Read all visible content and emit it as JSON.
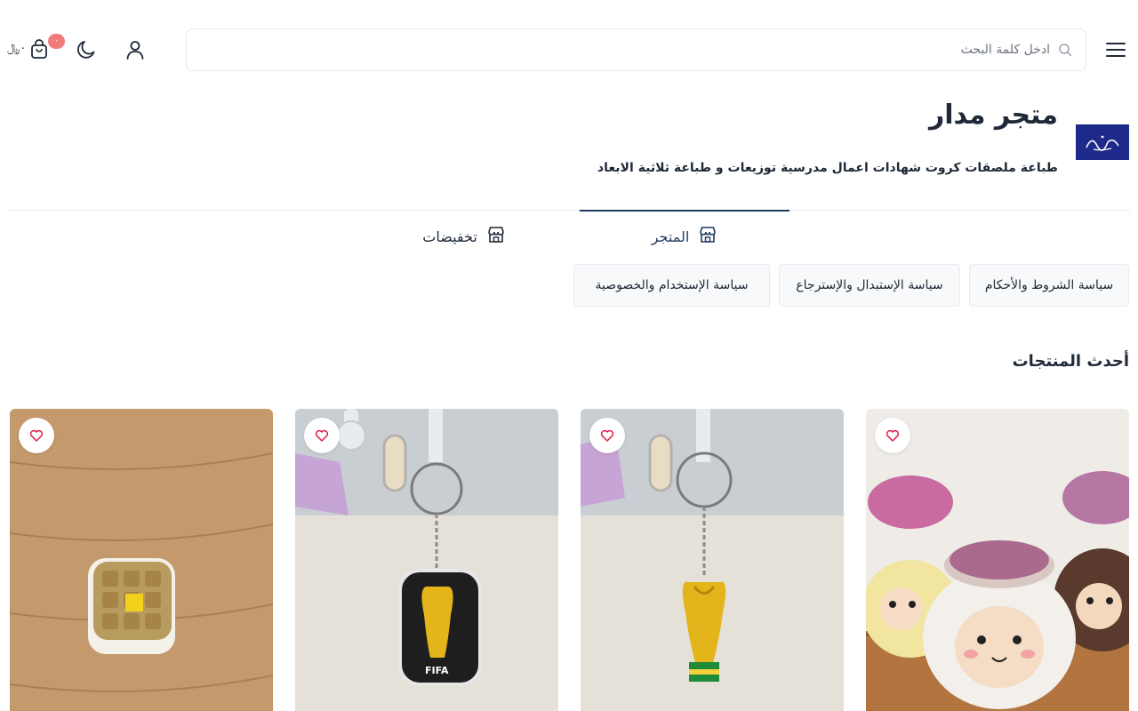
{
  "header": {
    "search_placeholder": "ادخل كلمة البحث",
    "cart_total": "٠﷼",
    "cart_count": "٠"
  },
  "store": {
    "name": "متجر مدار",
    "description": "طباعة ملصقات كروت شهادات اعمال مدرسية توزيعات و طباعة ثلاثية الابعاد",
    "logo_color": "#1e2a8a"
  },
  "tabs": [
    {
      "label": "المتجر",
      "icon": "store-icon",
      "active": true
    },
    {
      "label": "تخفيضات",
      "icon": "store-icon",
      "active": false
    }
  ],
  "policies": [
    {
      "label": "سياسة الشروط والأحكام"
    },
    {
      "label": "سياسة الإستبدال والإسترجاع"
    },
    {
      "label": "سياسة الإستخدام والخصوصية"
    }
  ],
  "sections": {
    "latest_title": "أحدث المنتجات"
  },
  "products": [
    {
      "image": "sheep-planters"
    },
    {
      "image": "world-cup-trophy-keychain"
    },
    {
      "image": "fifa-trophy-keychain"
    },
    {
      "image": "waffle-box"
    }
  ],
  "colors": {
    "accent": "#1e3a5f",
    "badge": "#f47b7b",
    "heart": "#e11d48"
  }
}
